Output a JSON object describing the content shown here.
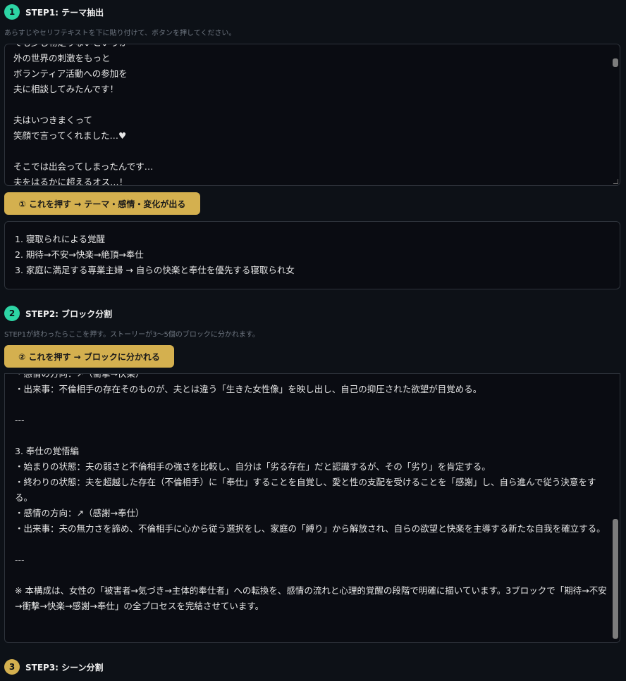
{
  "colors": {
    "step1_badge": "#2dd4a4",
    "step2_badge": "#2dd4a4",
    "step3_badge": "#d4b04f",
    "button_bg": "#d4b04f",
    "panel_bg": "#0a0c12",
    "page_bg": "#0d1117"
  },
  "step1": {
    "number": "1",
    "title": "STEP1: テーマ抽出",
    "hint": "あらすじやセリフテキストを下に貼り付けて、ボタンを押してください。",
    "textarea_lines": [
      "でも少し物足りないというか",
      "外の世界の刺激をもっと",
      "ボランティア活動への参加を",
      "夫に相談してみたんです！",
      "",
      "夫はいつきまくって",
      "笑顔で言ってくれました…♥",
      "",
      "そこでは出会ってしまったんです…",
      "夫をはるかに超えるオス…！"
    ],
    "button_label": "① これを押す → テーマ・感情・変化が出る",
    "results": [
      "1. 寝取られによる覚醒",
      "2. 期待→不安→快楽→絶頂→奉仕",
      "3. 家庭に満足する専業主婦 → 自らの快楽と奉仕を優先する寝取られ女"
    ]
  },
  "step2": {
    "number": "2",
    "title": "STEP2: ブロック分割",
    "hint": "STEP1が終わったらここを押す。ストーリーが3～5個のブロックに分かれます。",
    "button_label": "② これを押す → ブロックに分かれる",
    "output_lines": [
      "・感情の方向：↗（衝撃→快楽）",
      "・出来事：不倫相手の存在そのものが、夫とは違う「生きた女性像」を映し出し、自己の抑圧された欲望が目覚める。",
      "",
      "---",
      "",
      "3. 奉仕の覚悟編",
      "・始まりの状態：夫の弱さと不倫相手の強さを比較し、自分は「劣る存在」だと認識するが、その「劣り」を肯定する。",
      "・終わりの状態：夫を超越した存在（不倫相手）に「奉仕」することを自覚し、愛と性の支配を受けることを「感謝」し、自ら進んで従う決意をする。",
      "・感情の方向：↗（感謝→奉仕）",
      "・出来事：夫の無力さを諦め、不倫相手に心から従う選択をし、家庭の「縛り」から解放され、自らの欲望と快楽を主導する新たな自我を確立する。",
      "",
      "---",
      "",
      "※ 本構成は、女性の「被害者→気づき→主体的奉仕者」への転換を、感情の流れと心理的覚醒の段階で明確に描いています。3ブロックで「期待→不安→衝撃→快楽→感謝→奉仕」の全プロセスを完結させています。"
    ]
  },
  "step3": {
    "number": "3",
    "title": "STEP3: シーン分割"
  }
}
